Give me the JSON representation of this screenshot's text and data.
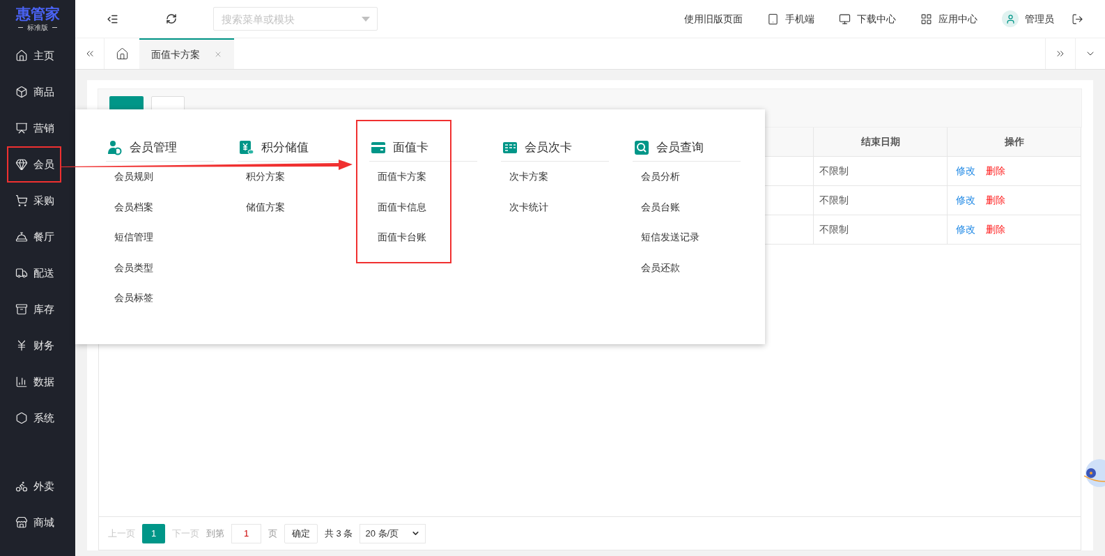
{
  "logo": {
    "name": "惠管家",
    "edition": "标准版"
  },
  "sidebar": {
    "items": [
      {
        "label": "主页",
        "marked": false
      },
      {
        "label": "商品",
        "marked": false
      },
      {
        "label": "营销",
        "marked": false
      },
      {
        "label": "会员",
        "marked": true
      },
      {
        "label": "采购",
        "marked": false
      },
      {
        "label": "餐厅",
        "marked": false
      },
      {
        "label": "配送",
        "marked": false
      },
      {
        "label": "库存",
        "marked": false
      },
      {
        "label": "财务",
        "marked": false
      },
      {
        "label": "数据",
        "marked": false
      },
      {
        "label": "系统",
        "marked": false
      }
    ],
    "bottom_items": [
      {
        "label": "外卖"
      },
      {
        "label": "商城"
      }
    ]
  },
  "topbar": {
    "search": {
      "placeholder": "搜索菜单或模块"
    },
    "links": [
      "使用旧版页面",
      "手机端",
      "下载中心",
      "应用中心",
      "管理员"
    ]
  },
  "tabs": [
    {
      "label": "面值卡方案",
      "selected": true
    }
  ],
  "table": {
    "columns": [
      "结束日期",
      "操作"
    ],
    "rows": [
      {
        "end_date": "不限制",
        "actions": [
          "修改",
          "删除"
        ]
      },
      {
        "end_date": "不限制",
        "actions": [
          "修改",
          "删除"
        ]
      },
      {
        "end_date": "不限制",
        "actions": [
          "修改",
          "删除"
        ]
      }
    ]
  },
  "pagination": {
    "prev": "上一页",
    "pages": [
      {
        "label": "1",
        "selected": true
      }
    ],
    "next": "下一页",
    "goto": "到第",
    "page_value": "1",
    "page_unit": "页",
    "confirm": "确定",
    "total": "共 3 条",
    "page_size": "20 条/页"
  },
  "mega_menu": {
    "columns": [
      {
        "title": "会员管理",
        "marked": false,
        "items": [
          "会员规则",
          "会员档案",
          "短信管理",
          "会员类型",
          "会员标签"
        ]
      },
      {
        "title": "积分储值",
        "marked": false,
        "items": [
          "积分方案",
          "储值方案"
        ]
      },
      {
        "title": "面值卡",
        "marked": true,
        "items": [
          "面值卡方案",
          "面值卡信息",
          "面值卡台账"
        ]
      },
      {
        "title": "会员次卡",
        "marked": false,
        "items": [
          "次卡方案",
          "次卡统计"
        ]
      },
      {
        "title": "会员查询",
        "marked": false,
        "items": [
          "会员分析",
          "会员台账",
          "短信发送记录",
          "会员还款"
        ]
      }
    ]
  }
}
